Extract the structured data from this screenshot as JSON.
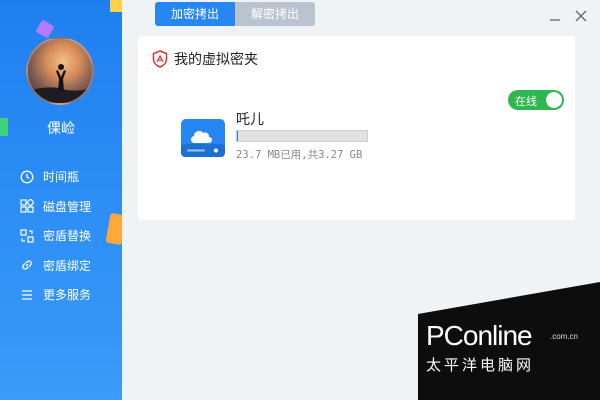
{
  "sidebar": {
    "username": "倮崄",
    "items": [
      {
        "label": "时间瓶",
        "icon": "clock-icon"
      },
      {
        "label": "磁盘管理",
        "icon": "grid-icon"
      },
      {
        "label": "密盾替换",
        "icon": "swap-icon"
      },
      {
        "label": "密盾绑定",
        "icon": "link-icon"
      },
      {
        "label": "更多服务",
        "icon": "menu-icon"
      }
    ]
  },
  "tabs": [
    {
      "label": "加密拷出",
      "active": true
    },
    {
      "label": "解密拷出",
      "active": false
    }
  ],
  "vault": {
    "title": "我的虚拟密夹",
    "toggle_label": "在线",
    "toggle_on": true,
    "drive": {
      "name": "吒儿",
      "usage_text": "23.7 MB已用,共3.27 GB",
      "used_fraction": 0.007
    }
  },
  "watermark": {
    "brand": "PConline",
    "domain": ".com.cn",
    "cn": "太平洋电脑网"
  },
  "colors": {
    "accent": "#2686f2",
    "toggle": "#2fb64d"
  }
}
